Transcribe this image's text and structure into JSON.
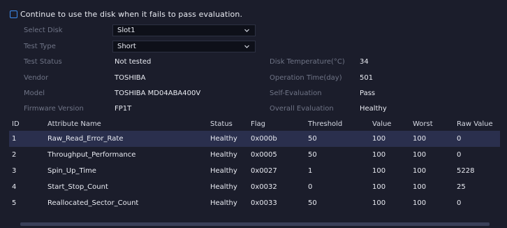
{
  "continue_checkbox": {
    "label": "Continue to use the disk when it fails to pass evaluation."
  },
  "form": {
    "select_disk": {
      "label": "Select Disk",
      "value": "Slot1"
    },
    "test_type": {
      "label": "Test Type",
      "value": "Short"
    },
    "test_status": {
      "label": "Test Status",
      "value": "Not tested"
    },
    "vendor": {
      "label": "Vendor",
      "value": "TOSHIBA"
    },
    "model": {
      "label": "Model",
      "value": "TOSHIBA MD04ABA400V"
    },
    "firmware_version": {
      "label": "Firmware Version",
      "value": "FP1T"
    },
    "disk_temperature": {
      "label": "Disk Temperature(°C)",
      "value": "34"
    },
    "operation_time": {
      "label": "Operation Time(day)",
      "value": "501"
    },
    "self_evaluation": {
      "label": "Self-Evaluation",
      "value": "Pass"
    },
    "overall_evaluation": {
      "label": "Overall Evaluation",
      "value": "Healthy"
    }
  },
  "table": {
    "columns": [
      "ID",
      "Attribute Name",
      "Status",
      "Flag",
      "Threshold",
      "Value",
      "Worst",
      "Raw Value"
    ],
    "rows": [
      {
        "id": "1",
        "name": "Raw_Read_Error_Rate",
        "status": "Healthy",
        "flag": "0x000b",
        "threshold": "50",
        "value": "100",
        "worst": "100",
        "raw": "0"
      },
      {
        "id": "2",
        "name": "Throughput_Performance",
        "status": "Healthy",
        "flag": "0x0005",
        "threshold": "50",
        "value": "100",
        "worst": "100",
        "raw": "0"
      },
      {
        "id": "3",
        "name": "Spin_Up_Time",
        "status": "Healthy",
        "flag": "0x0027",
        "threshold": "1",
        "value": "100",
        "worst": "100",
        "raw": "5228"
      },
      {
        "id": "4",
        "name": "Start_Stop_Count",
        "status": "Healthy",
        "flag": "0x0032",
        "threshold": "0",
        "value": "100",
        "worst": "100",
        "raw": "25"
      },
      {
        "id": "5",
        "name": "Reallocated_Sector_Count",
        "status": "Healthy",
        "flag": "0x0033",
        "threshold": "50",
        "value": "100",
        "worst": "100",
        "raw": "0"
      }
    ]
  },
  "colors": {
    "accent": "#3d8cf0",
    "row_highlight": "#2a2f4d",
    "background": "#1b1d2b",
    "label_muted": "#6f7486"
  },
  "icons": {
    "dropdown": "chevron-down-icon"
  }
}
